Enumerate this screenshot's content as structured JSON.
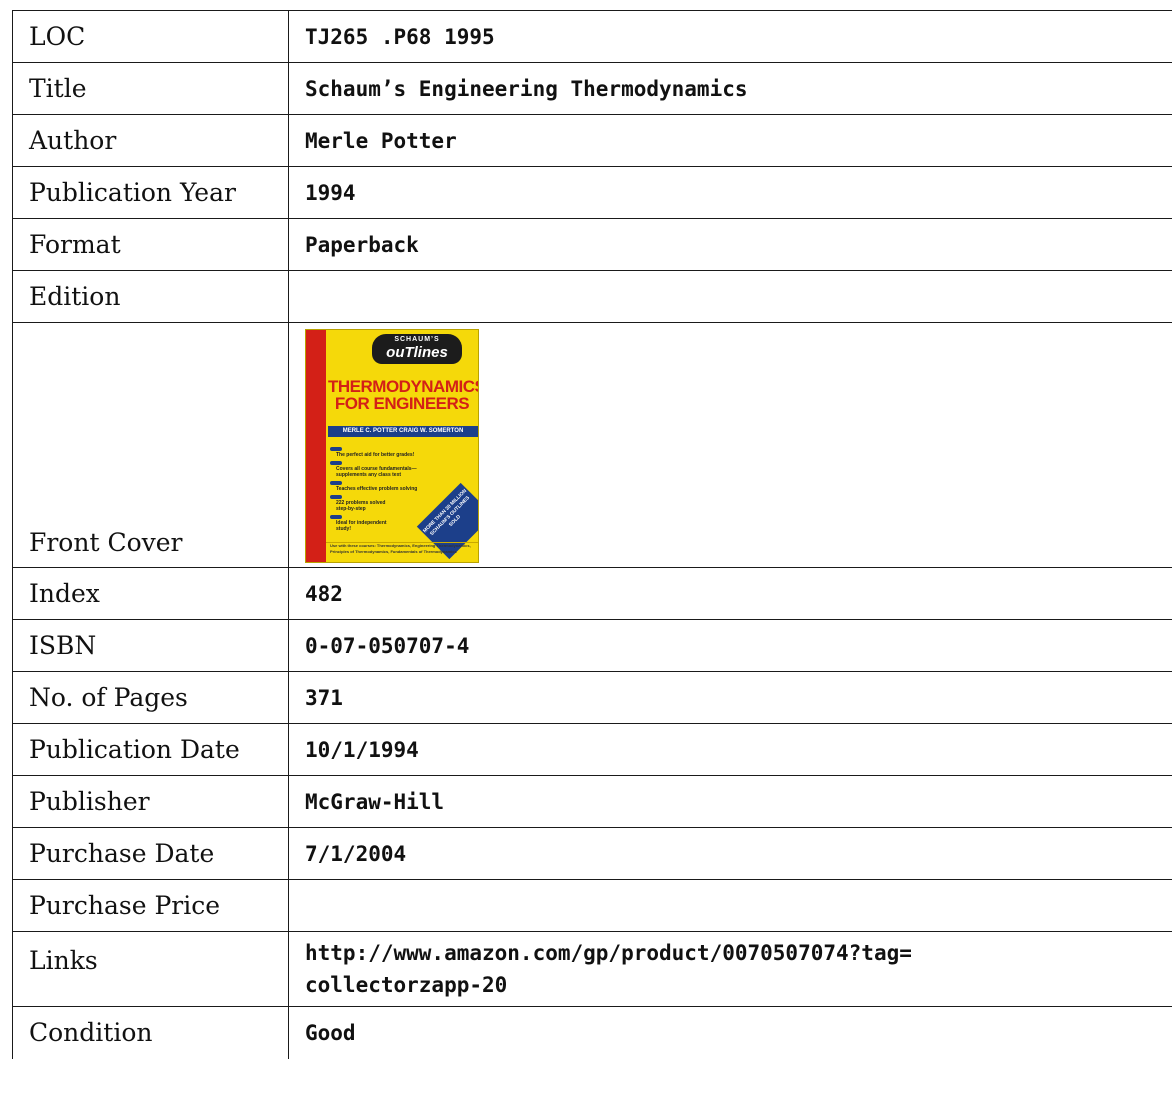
{
  "rows": {
    "loc": {
      "label": "LOC",
      "value": "TJ265 .P68 1995"
    },
    "title": {
      "label": "Title",
      "value": "Schaum’s Engineering Thermodynamics"
    },
    "author": {
      "label": "Author",
      "value": "Merle Potter"
    },
    "publication_year": {
      "label": "Publication Year",
      "value": "1994"
    },
    "format": {
      "label": "Format",
      "value": "Paperback"
    },
    "edition": {
      "label": "Edition",
      "value": ""
    },
    "front_cover": {
      "label": "Front Cover"
    },
    "index": {
      "label": "Index",
      "value": "482"
    },
    "isbn": {
      "label": "ISBN",
      "value": "0-07-050707-4"
    },
    "pages": {
      "label": "No. of Pages",
      "value": "371"
    },
    "publication_date": {
      "label": "Publication Date",
      "value": "10/1/1994"
    },
    "publisher": {
      "label": "Publisher",
      "value": "McGraw-Hill"
    },
    "purchase_date": {
      "label": "Purchase Date",
      "value": "7/1/2004"
    },
    "purchase_price": {
      "label": "Purchase Price",
      "value": ""
    },
    "links": {
      "label": "Links",
      "line1": "http://www.amazon.com/gp/product/0070507074?tag=",
      "line2": "collectorzapp-20"
    },
    "condition": {
      "label": "Condition",
      "value": "Good"
    }
  },
  "cover": {
    "badge_top": "SCHAUM’S",
    "badge_main": "ouTlines",
    "title_line1": "THERMODYNAMICS",
    "title_line2": "FOR ENGINEERS",
    "authors": "MERLE C. POTTER    CRAIG W. SOMERTON",
    "bullets": [
      "The perfect aid for better grades!",
      "Covers all course fundamentals— supplements any class text",
      "Teaches effective problem solving",
      "222 problems solved step-by-step",
      "Ideal for independent study!"
    ],
    "stamp": "MORE THAN 30 MILLION SCHAUM’S OUTLINES SOLD",
    "footer": "Use with these courses: Thermodynamics, Engineering Thermodynamics, Principles of Thermodynamics, Fundamentals of Thermodynamics",
    "colors": {
      "background": "#f5d90a",
      "spine": "#d32017",
      "title": "#d32017",
      "band": "#1c3f8a"
    }
  }
}
